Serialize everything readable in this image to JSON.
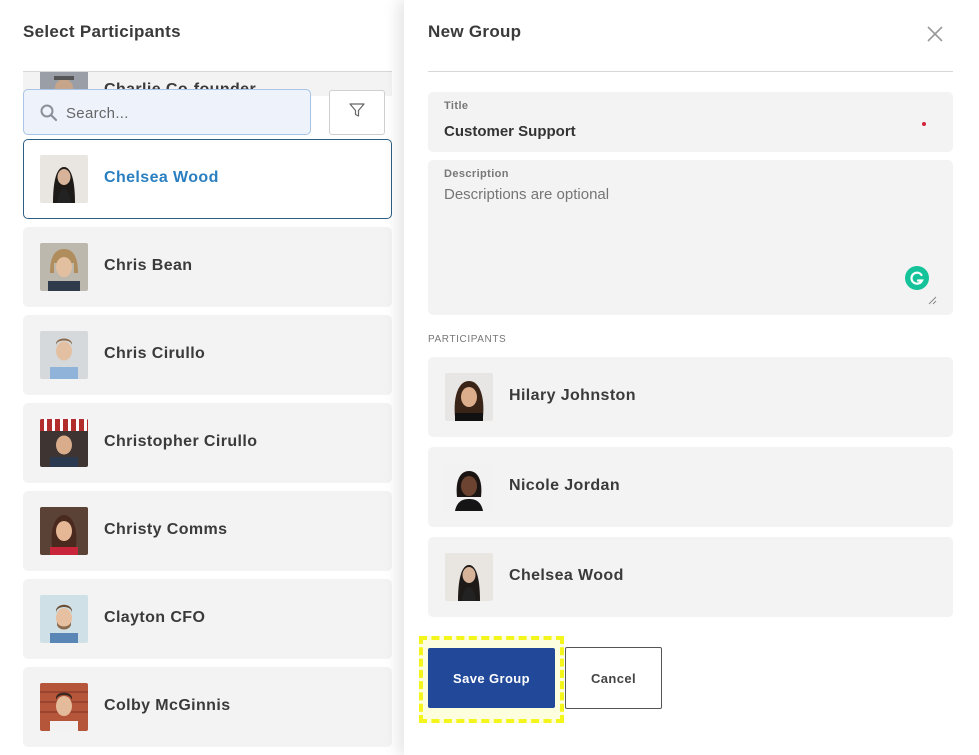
{
  "left_panel": {
    "title": "Select Participants",
    "partial_row_name": "Charlie Co-founder",
    "search": {
      "placeholder": "Search...",
      "value": ""
    },
    "participants": [
      {
        "name": "Chelsea Wood",
        "selected": true
      },
      {
        "name": "Chris Bean",
        "selected": false
      },
      {
        "name": "Chris Cirullo",
        "selected": false
      },
      {
        "name": "Christopher Cirullo",
        "selected": false
      },
      {
        "name": "Christy Comms",
        "selected": false
      },
      {
        "name": "Clayton CFO",
        "selected": false
      },
      {
        "name": "Colby McGinnis",
        "selected": false
      }
    ]
  },
  "right_panel": {
    "title": "New Group",
    "title_field": {
      "label": "Title",
      "value": "Customer Support"
    },
    "description_field": {
      "label": "Description",
      "placeholder": "Descriptions are optional",
      "value": ""
    },
    "participants_label": "PARTICIPANTS",
    "selected_participants": [
      {
        "name": "Hilary Johnston"
      },
      {
        "name": "Nicole Jordan"
      },
      {
        "name": "Chelsea Wood"
      }
    ],
    "save_label": "Save Group",
    "cancel_label": "Cancel"
  },
  "colors": {
    "primary_button": "#22489a",
    "selected_text": "#2a7fc1",
    "selected_border": "#2d5f84",
    "highlight": "#f4f51a",
    "grammarly": "#15c39a",
    "required_dot": "#d6213b"
  },
  "icons": [
    "search-icon",
    "filter-icon",
    "close-icon",
    "grammarly-icon"
  ]
}
